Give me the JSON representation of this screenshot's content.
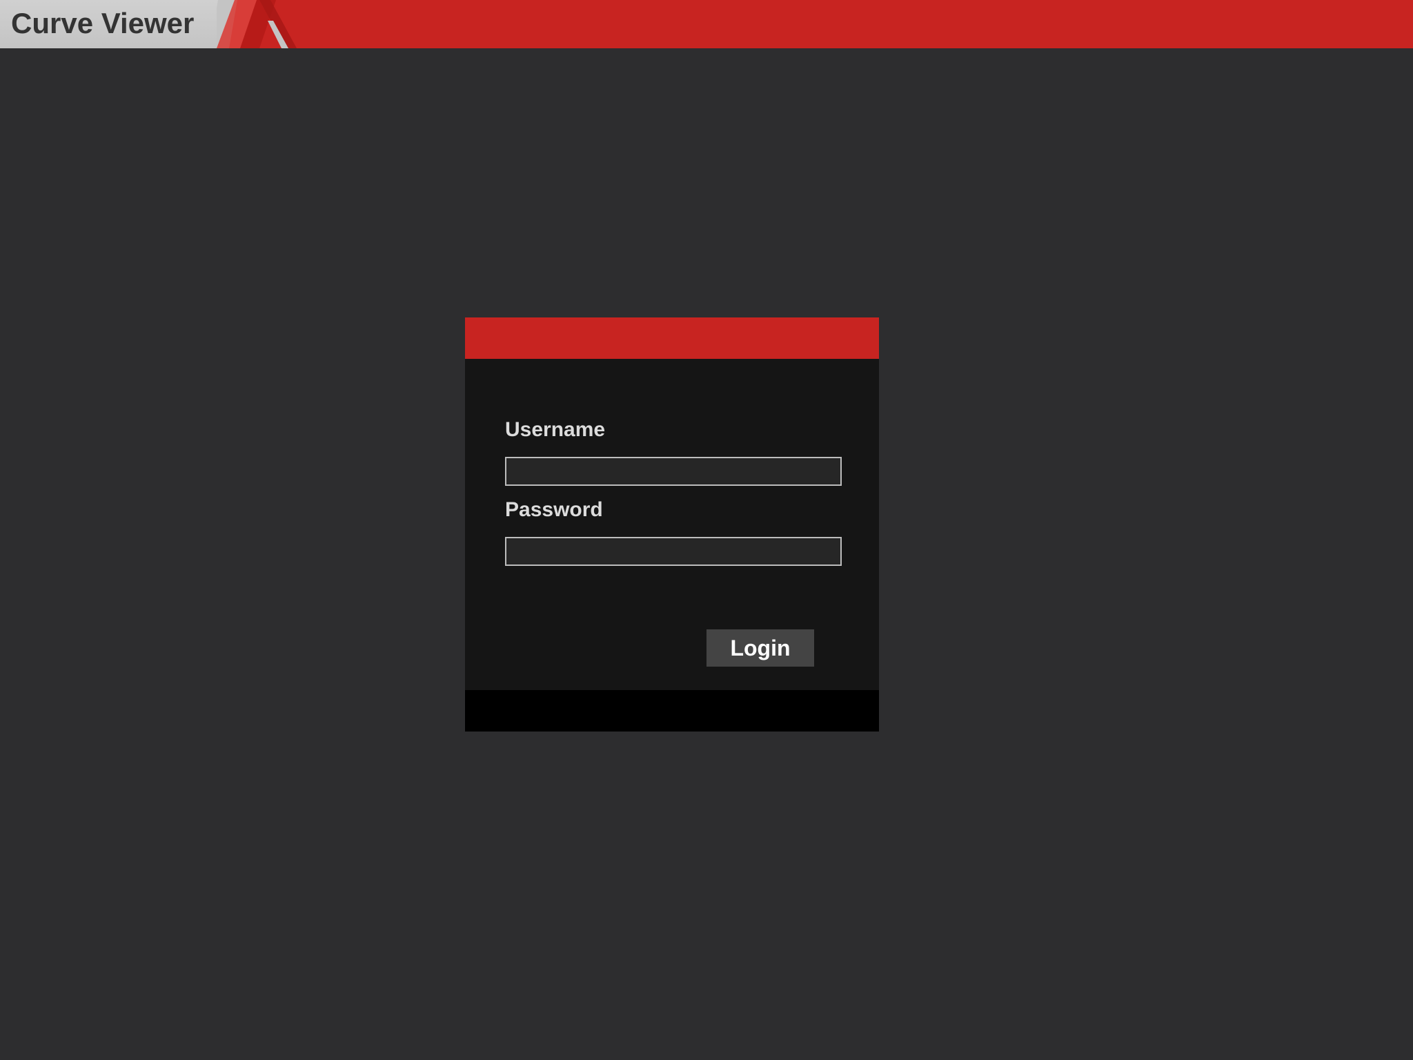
{
  "app": {
    "title": "Curve Viewer"
  },
  "colors": {
    "accent": "#c82421",
    "background": "#2d2d2f",
    "dialog_body": "#151515",
    "dialog_footer": "#000000",
    "button": "#444444"
  },
  "login_form": {
    "username_label": "Username",
    "username_value": "",
    "password_label": "Password",
    "password_value": "",
    "login_button_label": "Login"
  },
  "icons": {
    "logo": "stripes-logo"
  }
}
